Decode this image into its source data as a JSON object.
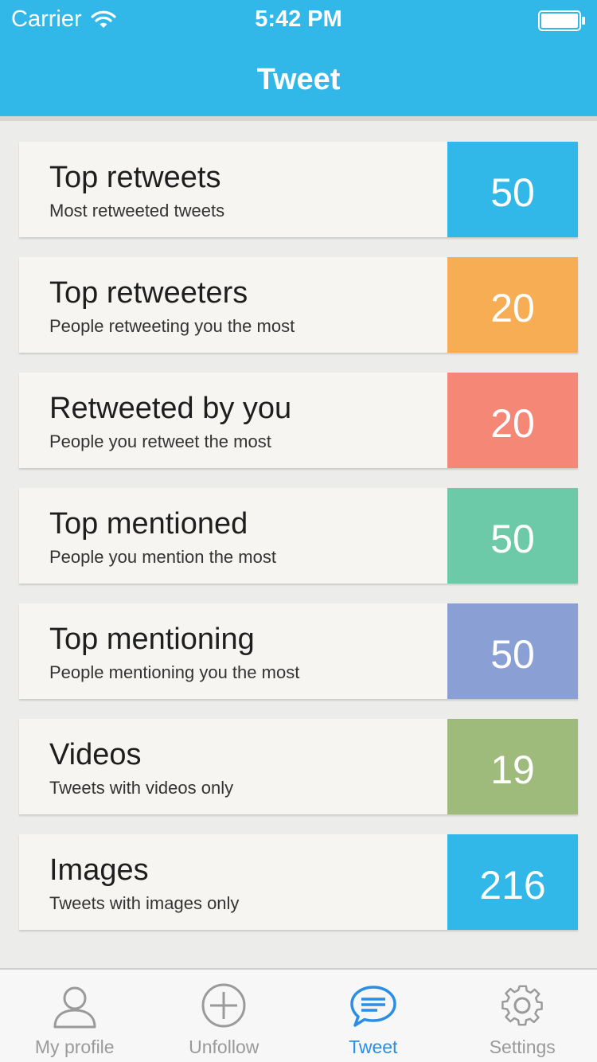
{
  "status_bar": {
    "carrier": "Carrier",
    "time": "5:42 PM"
  },
  "nav": {
    "title": "Tweet"
  },
  "items": [
    {
      "title": "Top retweets",
      "subtitle": "Most retweeted tweets",
      "count": "50",
      "color": "#32b8e8"
    },
    {
      "title": "Top retweeters",
      "subtitle": "People retweeting you the most",
      "count": "20",
      "color": "#f6ad53"
    },
    {
      "title": "Retweeted by you",
      "subtitle": "People you retweet the most",
      "count": "20",
      "color": "#f48776"
    },
    {
      "title": "Top mentioned",
      "subtitle": "People you mention the most",
      "count": "50",
      "color": "#6ccaa8"
    },
    {
      "title": "Top mentioning",
      "subtitle": "People mentioning you the most",
      "count": "50",
      "color": "#8a9fd4"
    },
    {
      "title": "Videos",
      "subtitle": "Tweets with videos only",
      "count": "19",
      "color": "#9ebb7c"
    },
    {
      "title": "Images",
      "subtitle": "Tweets with images only",
      "count": "216",
      "color": "#32b8e8"
    }
  ],
  "tabs": [
    {
      "label": "My profile",
      "icon": "person-icon",
      "active": false
    },
    {
      "label": "Unfollow",
      "icon": "plus-circle-icon",
      "active": false
    },
    {
      "label": "Tweet",
      "icon": "speech-bubble-icon",
      "active": true
    },
    {
      "label": "Settings",
      "icon": "gear-icon",
      "active": false
    }
  ],
  "colors": {
    "accent": "#32b8e8",
    "active_tab": "#2a8ee6",
    "inactive_tab": "#9a9a9a"
  }
}
